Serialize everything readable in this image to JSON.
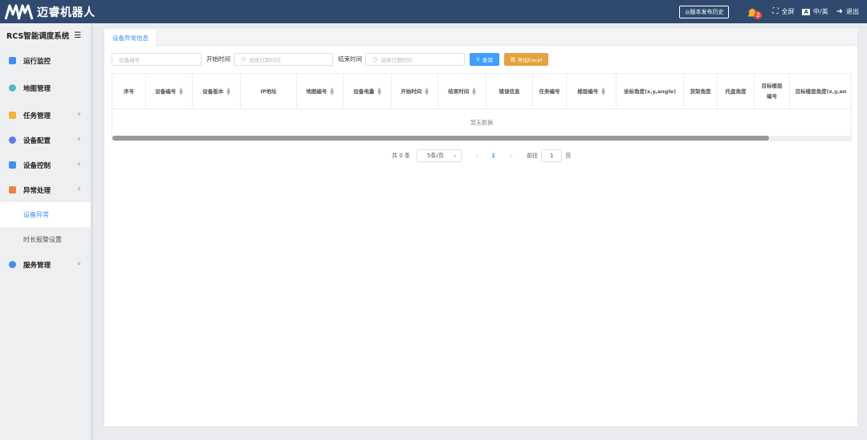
{
  "header": {
    "brand": "迈睿机器人",
    "history_button": "◎版本发布历史",
    "alert_count": "2",
    "fullscreen": "全屏",
    "language": "中/英",
    "logout": "退出"
  },
  "sidebar": {
    "title": "RCS智能调度系统",
    "items": [
      {
        "label": "运行监控",
        "color": "#3d8ff5"
      },
      {
        "label": "地图管理",
        "color": "#52b8c8"
      },
      {
        "label": "任务管理",
        "color": "#f2b430"
      },
      {
        "label": "设备配置",
        "color": "#5b7cf0"
      },
      {
        "label": "设备控制",
        "color": "#3d8ff5"
      },
      {
        "label": "异常处理",
        "color": "#f0803c"
      },
      {
        "label": "服务管理",
        "color": "#3d8ff5"
      }
    ],
    "sub_items": [
      {
        "label": "设备异常"
      },
      {
        "label": "时长报警设置"
      }
    ]
  },
  "tabs": [
    {
      "label": "设备异常信息"
    }
  ],
  "filters": {
    "device_placeholder": "设备编号",
    "start_label": "开始时间",
    "start_placeholder": "选择日期时间",
    "end_label": "结束时间",
    "end_placeholder": "选择日期时间",
    "query_label": "查询",
    "export_label": "导出Excel"
  },
  "table": {
    "columns": [
      {
        "label": "序号"
      },
      {
        "label": "设备编号"
      },
      {
        "label": "设备版本"
      },
      {
        "label": "IP地址"
      },
      {
        "label": "地图编号"
      },
      {
        "label": "设备电量"
      },
      {
        "label": "开始时间"
      },
      {
        "label": "结束时间"
      },
      {
        "label": "错误信息"
      },
      {
        "label": "任务编号"
      },
      {
        "label": "楼层编号"
      },
      {
        "label": "坐标角度(x,y,angle)"
      },
      {
        "label": "货架角度"
      },
      {
        "label": "托盘角度"
      },
      {
        "label": "目标楼层\n编号"
      },
      {
        "label": "目标楼层角度(x,y,an"
      }
    ],
    "empty_text": "暂无数据"
  },
  "pagination": {
    "total": "共 0 条",
    "page_size": "5条/页",
    "current_page": "1",
    "goto_label": "前往",
    "goto_value": "1",
    "page_suffix": "页"
  }
}
